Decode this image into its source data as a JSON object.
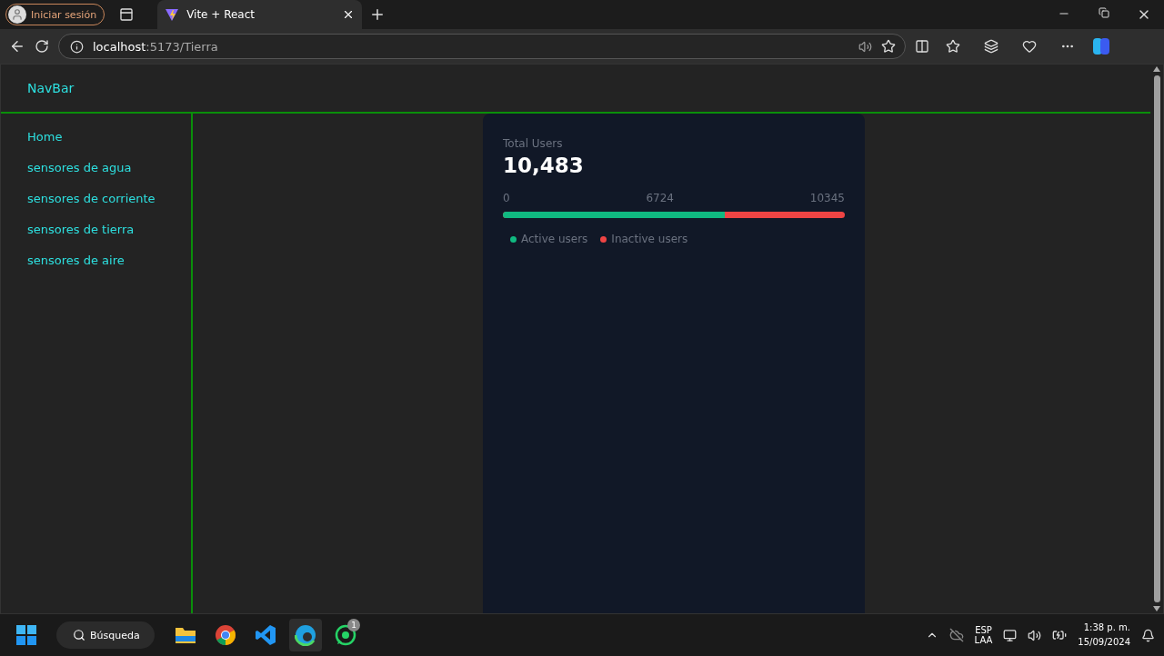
{
  "browser": {
    "profile": "Iniciar sesión",
    "tab": {
      "title": "Vite + React"
    },
    "address": {
      "host": "localhost",
      "path": ":5173/Tierra"
    }
  },
  "navbar": {
    "title": "NavBar"
  },
  "sidebar": {
    "items": [
      {
        "label": "Home"
      },
      {
        "label": "sensores de agua"
      },
      {
        "label": "sensores de corriente"
      },
      {
        "label": "sensores de tierra"
      },
      {
        "label": "sensores de aire"
      }
    ]
  },
  "card": {
    "title": "Total Users",
    "value": "10,483",
    "scale": [
      "0",
      "6724",
      "10345"
    ],
    "bar": {
      "level": 0.65
    },
    "legend": [
      {
        "label": "Active users",
        "color": "#10b981"
      },
      {
        "label": "Inactive users",
        "color": "#ef4444"
      }
    ]
  },
  "taskbar": {
    "search": "Búsqueda",
    "apps": [
      {
        "kind": "files",
        "selected": false
      },
      {
        "kind": "chrome",
        "selected": false
      },
      {
        "kind": "vscode",
        "selected": false
      },
      {
        "kind": "edge",
        "selected": true
      },
      {
        "kind": "whatsapp",
        "selected": false,
        "badge": "1"
      }
    ],
    "language": [
      "ESP",
      "LAA"
    ],
    "time": "1:38 p. m.",
    "date": "15/09/2024"
  }
}
